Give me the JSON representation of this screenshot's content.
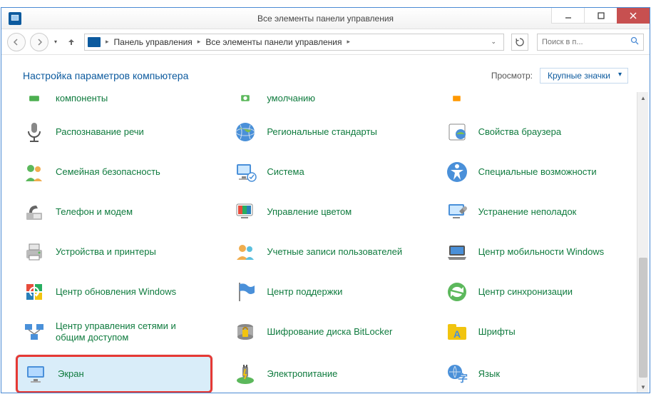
{
  "window": {
    "title": "Все элементы панели управления"
  },
  "breadcrumb": {
    "item1": "Панель управления",
    "item2": "Все элементы панели управления"
  },
  "search": {
    "placeholder": "Поиск в п..."
  },
  "page": {
    "heading": "Настройка параметров компьютера",
    "view_label": "Просмотр:",
    "view_value": "Крупные значки"
  },
  "items": {
    "r0c0": "компоненты",
    "r0c1": "умолчанию",
    "r1c0": "Распознавание речи",
    "r1c1": "Региональные стандарты",
    "r1c2": "Свойства браузера",
    "r2c0": "Семейная безопасность",
    "r2c1": "Система",
    "r2c2": "Специальные возможности",
    "r3c0": "Телефон и модем",
    "r3c1": "Управление цветом",
    "r3c2": "Устранение неполадок",
    "r4c0": "Устройства и принтеры",
    "r4c1": "Учетные записи пользователей",
    "r4c2": "Центр мобильности Windows",
    "r5c0": "Центр обновления Windows",
    "r5c1": "Центр поддержки",
    "r5c2": "Центр синхронизации",
    "r6c0": "Центр управления сетями и общим доступом",
    "r6c1": "Шифрование диска BitLocker",
    "r6c2": "Шрифты",
    "r7c0": "Экран",
    "r7c1": "Электропитание",
    "r7c2": "Язык"
  }
}
